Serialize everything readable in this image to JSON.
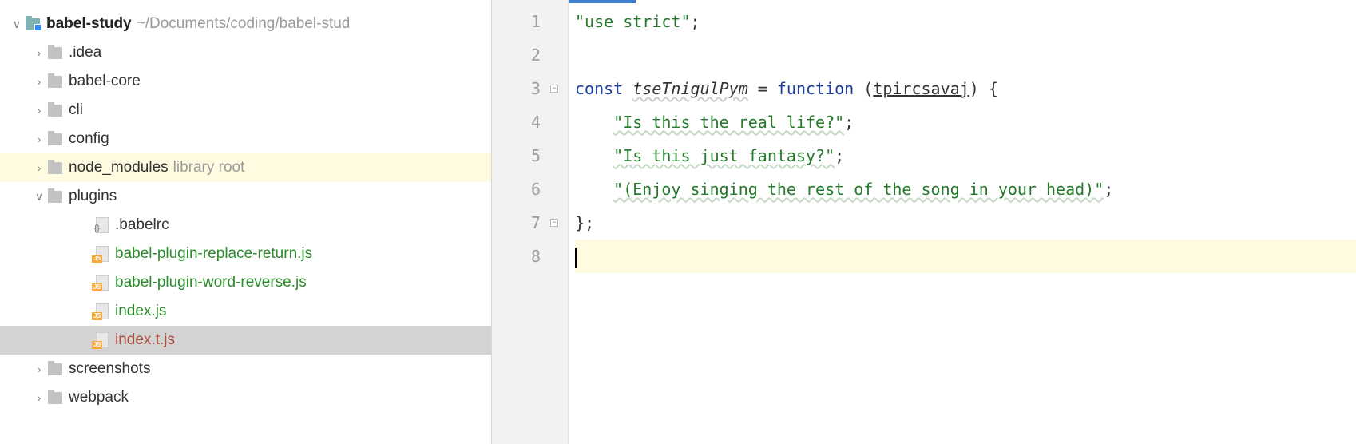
{
  "project": {
    "name": "babel-study",
    "path": "~/Documents/coding/babel-stud"
  },
  "tree": {
    "idea": ".idea",
    "babel_core": "babel-core",
    "cli": "cli",
    "config": "config",
    "node_modules": "node_modules",
    "node_modules_sub": "library root",
    "plugins": "plugins",
    "babelrc": ".babelrc",
    "plugin_replace": "babel-plugin-replace-return.js",
    "plugin_reverse": "babel-plugin-word-reverse.js",
    "index_js": "index.js",
    "index_t_js": "index.t.js",
    "screenshots": "screenshots",
    "webpack": "webpack"
  },
  "gutter": {
    "l1": "1",
    "l2": "2",
    "l3": "3",
    "l4": "4",
    "l5": "5",
    "l6": "6",
    "l7": "7",
    "l8": "8"
  },
  "code": {
    "l1_str": "\"use strict\"",
    "l1_semi": ";",
    "l3_const": "const",
    "l3_name": "tseTnigulPym",
    "l3_eq": " = ",
    "l3_func": "function",
    "l3_open": " (",
    "l3_param": "tpircsavaj",
    "l3_close": ") {",
    "l4_str": "\"Is this the real life?\"",
    "l4_semi": ";",
    "l5_str": "\"Is this just fantasy?\"",
    "l5_semi": ";",
    "l6_str": "\"(Enjoy singing the rest of the song in your head)\"",
    "l6_semi": ";",
    "l7_close": "};"
  }
}
